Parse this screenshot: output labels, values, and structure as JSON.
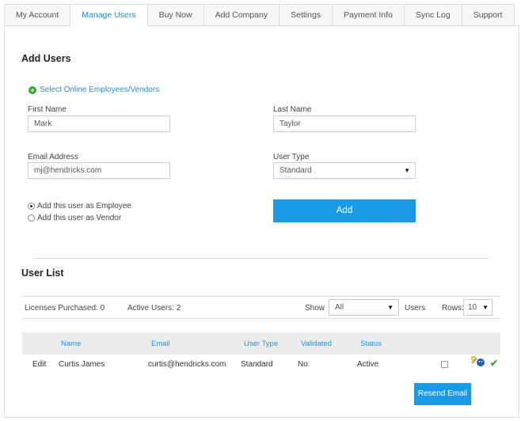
{
  "tabs": [
    {
      "label": "My Account"
    },
    {
      "label": "Manage Users",
      "active": true
    },
    {
      "label": "Buy Now"
    },
    {
      "label": "Add Company"
    },
    {
      "label": "Settings"
    },
    {
      "label": "Payment Info"
    },
    {
      "label": "Sync Log"
    },
    {
      "label": "Support"
    }
  ],
  "add_users": {
    "title": "Add Users",
    "select_link": "Select Online Employees/Vendors",
    "first_name_label": "First Name",
    "first_name_value": "Mark",
    "last_name_label": "Last Name",
    "last_name_value": "Taylor",
    "email_label": "Email Address",
    "email_value": "mj@hendricks.com",
    "user_type_label": "User Type",
    "user_type_value": "Standard",
    "radio_employee": "Add this user as Employee",
    "radio_vendor": "Add this user as Vendor",
    "add_button": "Add"
  },
  "user_list": {
    "title": "User List",
    "licenses_label": "Licenses Purchased:",
    "licenses_value": "0",
    "active_label": "Active Users:",
    "active_value": "2",
    "show_label": "Show",
    "show_value": "All",
    "users_label": "Users",
    "rows_label": "Rows:",
    "rows_value": "10",
    "columns": [
      "Name",
      "Email",
      "User Type",
      "Validated",
      "Status"
    ],
    "rows": [
      {
        "action": "Edit",
        "name": "Curtis James",
        "email": "curtis@hendricks.com",
        "user_type": "Standard",
        "validated": "No",
        "status": "Active"
      }
    ],
    "resend_button": "Resend Email"
  },
  "colors": {
    "accent": "#1a9ae6",
    "link": "#2a8fd6",
    "success": "#3aa536"
  }
}
